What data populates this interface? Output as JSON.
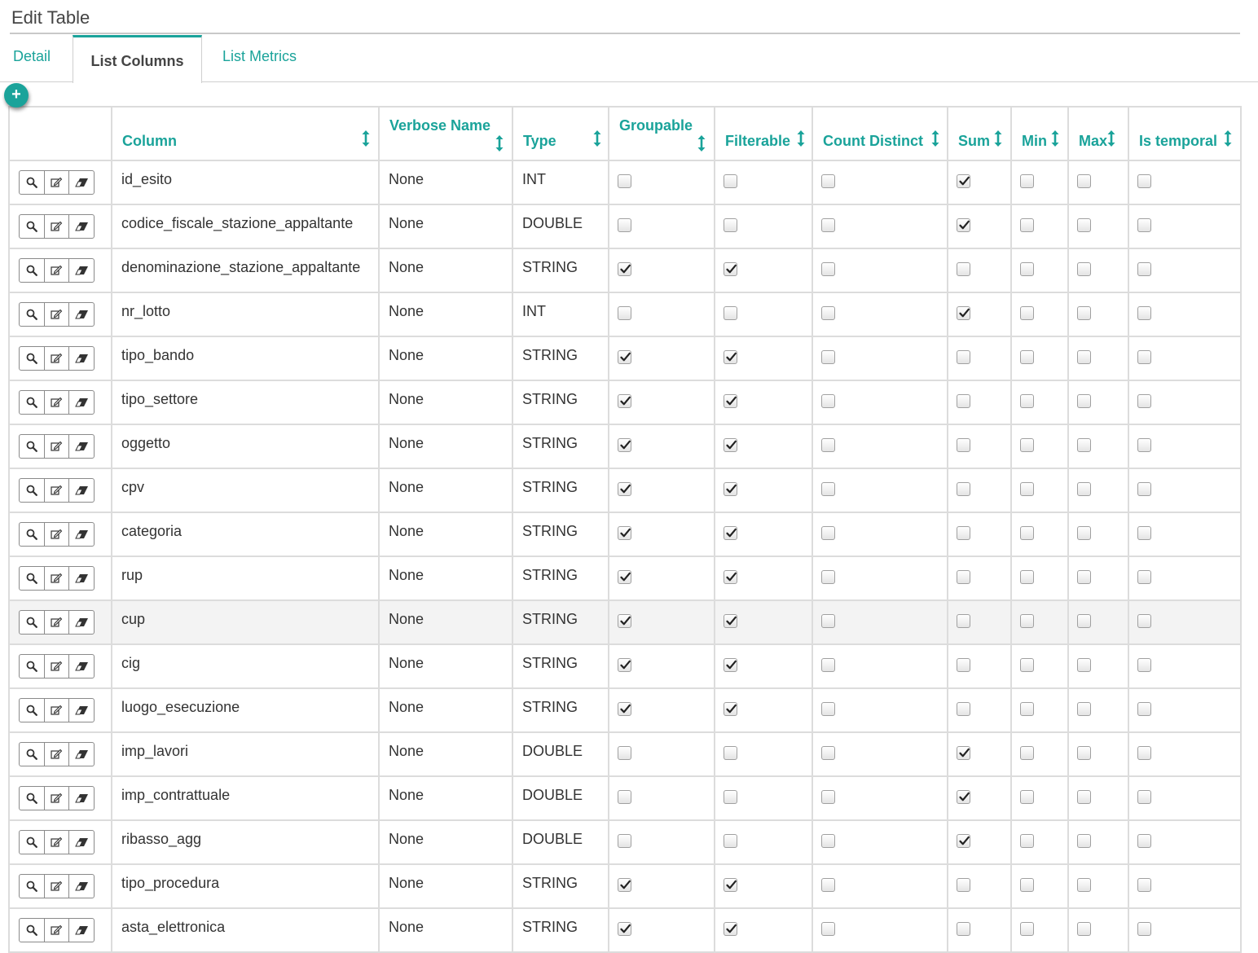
{
  "page": {
    "title": "Edit Table"
  },
  "tabs": [
    {
      "label": "Detail",
      "active": false
    },
    {
      "label": "List Columns",
      "active": true
    },
    {
      "label": "List Metrics",
      "active": false
    }
  ],
  "add_button": {
    "icon": "plus-icon",
    "label": "+"
  },
  "colors": {
    "accent": "#1aa39a",
    "border": "#dcdcdc",
    "text": "#333333"
  },
  "table": {
    "headers": {
      "column": "Column",
      "verbose_name": "Verbose Name",
      "type": "Type",
      "groupable": "Groupable",
      "filterable": "Filterable",
      "count_distinct": "Count Distinct",
      "sum": "Sum",
      "min": "Min",
      "max": "Max",
      "is_temporal": "Is temporal"
    },
    "row_actions": [
      "search-icon",
      "edit-icon",
      "eraser-icon"
    ],
    "rows": [
      {
        "column": "id_esito",
        "verbose": "None",
        "type": "INT",
        "groupable": false,
        "filterable": false,
        "count_distinct": false,
        "sum": true,
        "min": false,
        "max": false,
        "is_temporal": false
      },
      {
        "column": "codice_fiscale_stazione_appaltante",
        "verbose": "None",
        "type": "DOUBLE",
        "groupable": false,
        "filterable": false,
        "count_distinct": false,
        "sum": true,
        "min": false,
        "max": false,
        "is_temporal": false
      },
      {
        "column": "denominazione_stazione_appaltante",
        "verbose": "None",
        "type": "STRING",
        "groupable": true,
        "filterable": true,
        "count_distinct": false,
        "sum": false,
        "min": false,
        "max": false,
        "is_temporal": false
      },
      {
        "column": "nr_lotto",
        "verbose": "None",
        "type": "INT",
        "groupable": false,
        "filterable": false,
        "count_distinct": false,
        "sum": true,
        "min": false,
        "max": false,
        "is_temporal": false
      },
      {
        "column": "tipo_bando",
        "verbose": "None",
        "type": "STRING",
        "groupable": true,
        "filterable": true,
        "count_distinct": false,
        "sum": false,
        "min": false,
        "max": false,
        "is_temporal": false
      },
      {
        "column": "tipo_settore",
        "verbose": "None",
        "type": "STRING",
        "groupable": true,
        "filterable": true,
        "count_distinct": false,
        "sum": false,
        "min": false,
        "max": false,
        "is_temporal": false
      },
      {
        "column": "oggetto",
        "verbose": "None",
        "type": "STRING",
        "groupable": true,
        "filterable": true,
        "count_distinct": false,
        "sum": false,
        "min": false,
        "max": false,
        "is_temporal": false
      },
      {
        "column": "cpv",
        "verbose": "None",
        "type": "STRING",
        "groupable": true,
        "filterable": true,
        "count_distinct": false,
        "sum": false,
        "min": false,
        "max": false,
        "is_temporal": false
      },
      {
        "column": "categoria",
        "verbose": "None",
        "type": "STRING",
        "groupable": true,
        "filterable": true,
        "count_distinct": false,
        "sum": false,
        "min": false,
        "max": false,
        "is_temporal": false
      },
      {
        "column": "rup",
        "verbose": "None",
        "type": "STRING",
        "groupable": true,
        "filterable": true,
        "count_distinct": false,
        "sum": false,
        "min": false,
        "max": false,
        "is_temporal": false
      },
      {
        "column": "cup",
        "verbose": "None",
        "type": "STRING",
        "groupable": true,
        "filterable": true,
        "count_distinct": false,
        "sum": false,
        "min": false,
        "max": false,
        "is_temporal": false,
        "hover": true
      },
      {
        "column": "cig",
        "verbose": "None",
        "type": "STRING",
        "groupable": true,
        "filterable": true,
        "count_distinct": false,
        "sum": false,
        "min": false,
        "max": false,
        "is_temporal": false
      },
      {
        "column": "luogo_esecuzione",
        "verbose": "None",
        "type": "STRING",
        "groupable": true,
        "filterable": true,
        "count_distinct": false,
        "sum": false,
        "min": false,
        "max": false,
        "is_temporal": false
      },
      {
        "column": "imp_lavori",
        "verbose": "None",
        "type": "DOUBLE",
        "groupable": false,
        "filterable": false,
        "count_distinct": false,
        "sum": true,
        "min": false,
        "max": false,
        "is_temporal": false
      },
      {
        "column": "imp_contrattuale",
        "verbose": "None",
        "type": "DOUBLE",
        "groupable": false,
        "filterable": false,
        "count_distinct": false,
        "sum": true,
        "min": false,
        "max": false,
        "is_temporal": false
      },
      {
        "column": "ribasso_agg",
        "verbose": "None",
        "type": "DOUBLE",
        "groupable": false,
        "filterable": false,
        "count_distinct": false,
        "sum": true,
        "min": false,
        "max": false,
        "is_temporal": false
      },
      {
        "column": "tipo_procedura",
        "verbose": "None",
        "type": "STRING",
        "groupable": true,
        "filterable": true,
        "count_distinct": false,
        "sum": false,
        "min": false,
        "max": false,
        "is_temporal": false
      },
      {
        "column": "asta_elettronica",
        "verbose": "None",
        "type": "STRING",
        "groupable": true,
        "filterable": true,
        "count_distinct": false,
        "sum": false,
        "min": false,
        "max": false,
        "is_temporal": false
      }
    ]
  }
}
